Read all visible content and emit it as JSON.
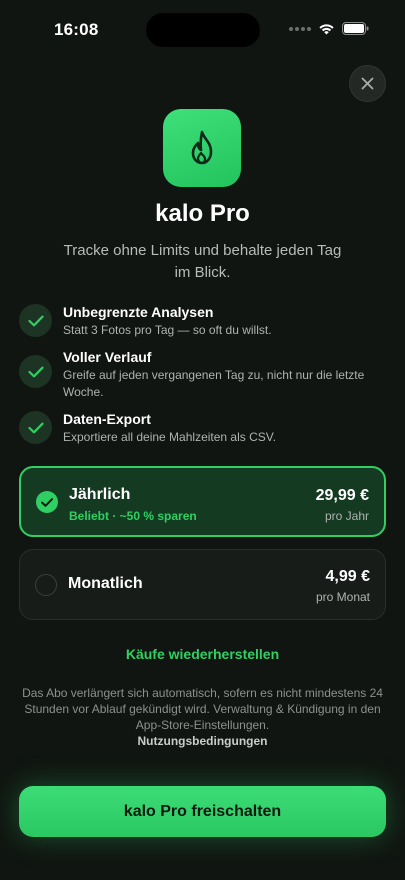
{
  "status_bar": {
    "time": "16:08"
  },
  "colors": {
    "accent": "#2fcf63",
    "background": "#101511",
    "icon_gradient_top": "#3fe07a"
  },
  "header": {
    "close_icon": "close-icon",
    "app_icon": "flame-icon",
    "title": "kalo Pro",
    "subtitle": "Tracke ohne Limits und behalte jeden Tag im Blick."
  },
  "features": [
    {
      "title": "Unbegrenzte Analysen",
      "desc": "Statt 3 Fotos pro Tag — so oft du willst."
    },
    {
      "title": "Voller Verlauf",
      "desc": "Greife auf jeden vergangenen Tag zu, nicht nur die letzte Woche."
    },
    {
      "title": "Daten-Export",
      "desc": "Exportiere all deine Mahlzeiten als CSV."
    }
  ],
  "plans": {
    "yearly": {
      "name": "Jährlich",
      "badge": "Beliebt · ~50 % sparen",
      "price": "29,99 €",
      "period": "pro Jahr",
      "selected": true
    },
    "monthly": {
      "name": "Monatlich",
      "price": "4,99 €",
      "period": "pro Monat",
      "selected": false
    }
  },
  "restore_label": "Käufe wiederherstellen",
  "legal": {
    "text": "Das Abo verlängert sich automatisch, sofern es nicht mindestens 24 Stunden vor Ablauf gekündigt wird. Verwaltung & Kündigung in den App-Store-Einstellungen.",
    "terms_label": "Nutzungsbedingungen"
  },
  "cta_label": "kalo Pro freischalten"
}
